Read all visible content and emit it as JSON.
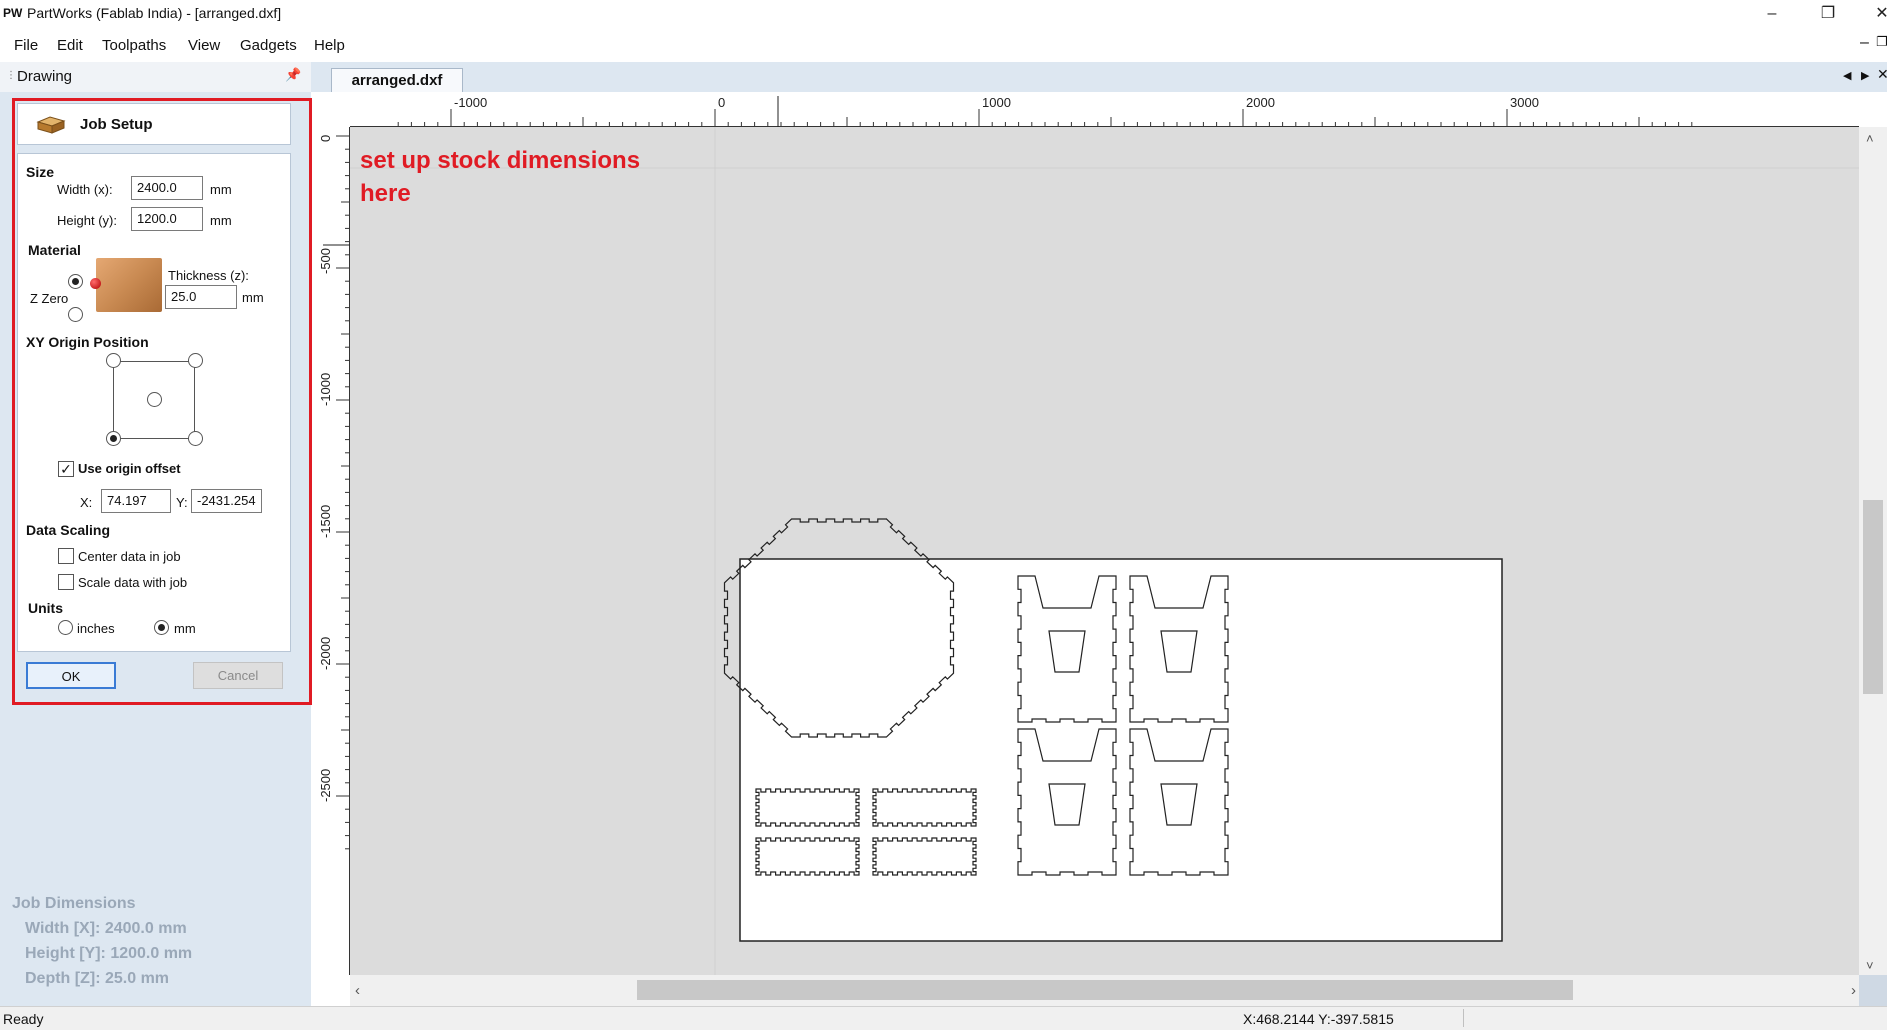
{
  "window": {
    "logo": "PW",
    "title": "PartWorks (Fablab India) - [arranged.dxf]",
    "controls": [
      "minimize-icon",
      "restore-icon",
      "close-icon"
    ]
  },
  "menu": [
    "File",
    "Edit",
    "Toolpaths",
    "View",
    "Gadgets",
    "Help"
  ],
  "left_panel": {
    "tab_label": "Drawing",
    "job_setup": {
      "header": "Job Setup",
      "size": {
        "label": "Size",
        "width_label": "Width (x):",
        "width_value": "2400.0",
        "height_label": "Height (y):",
        "height_value": "1200.0",
        "unit": "mm"
      },
      "material": {
        "label": "Material",
        "z_zero_label": "Z Zero",
        "z_zero_selected": "top",
        "thickness_label": "Thickness (z):",
        "thickness_value": "25.0",
        "unit": "mm"
      },
      "xy_origin": {
        "label": "XY Origin Position",
        "selected": "bottom-left",
        "use_offset_label": "Use origin offset",
        "use_offset_checked": true,
        "x_label": "X:",
        "x_value": "74.197",
        "y_label": "Y:",
        "y_value": "-2431.254"
      },
      "data_scaling": {
        "label": "Data Scaling",
        "center_label": "Center data in job",
        "center_checked": false,
        "scale_label": "Scale data with job",
        "scale_checked": false
      },
      "units": {
        "label": "Units",
        "inches_label": "inches",
        "mm_label": "mm",
        "selected": "mm"
      },
      "ok_label": "OK",
      "cancel_label": "Cancel"
    },
    "job_dimensions": {
      "title": "Job Dimensions",
      "width": "Width  [X]: 2400.0 mm",
      "height": "Height [Y]: 1200.0 mm",
      "depth": "Depth  [Z]: 25.0 mm"
    }
  },
  "document_tab": "arranged.dxf",
  "canvas": {
    "annotation_line1": "set up stock dimensions",
    "annotation_line2": "here",
    "annotation_color": "#e01b24",
    "h_ruler_labels": [
      "-1000",
      "0",
      "1000",
      "2000",
      "3000"
    ],
    "v_ruler_labels": [
      "0",
      "-500",
      "-1000",
      "-1500",
      "-2000",
      "-2500"
    ]
  },
  "status": {
    "left": "Ready",
    "coords": "X:468.2144 Y:-397.5815"
  }
}
